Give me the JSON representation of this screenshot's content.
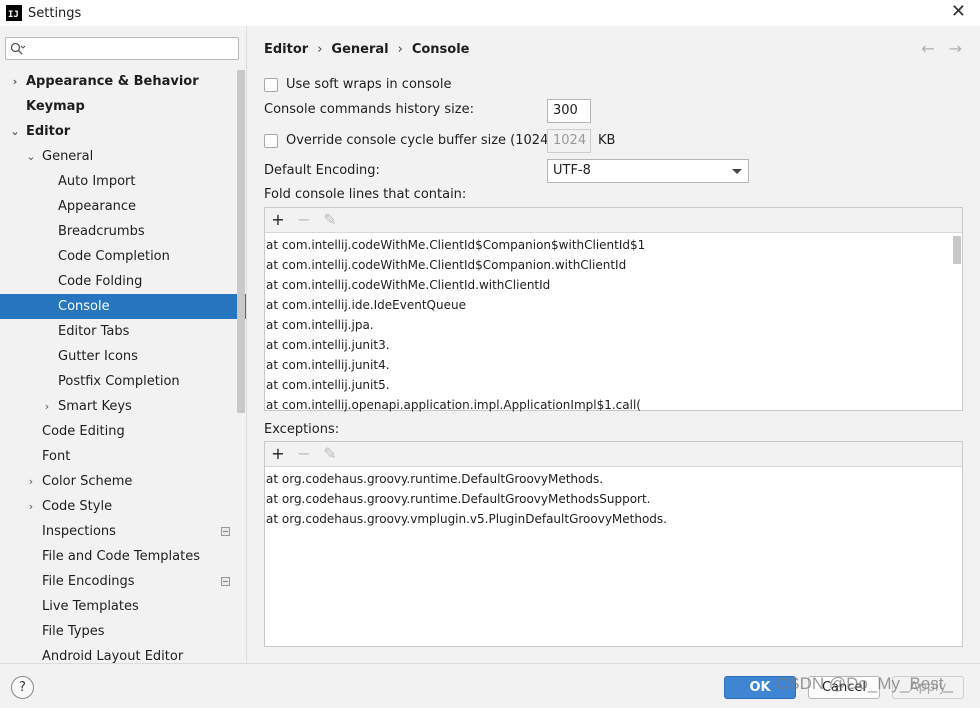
{
  "window": {
    "title": "Settings",
    "logo_text": "IJ"
  },
  "sidebar": {
    "search_placeholder": "",
    "items": [
      {
        "label": "Appearance & Behavior",
        "bold": true,
        "level": 0,
        "arrow": "›",
        "selected": false,
        "scope_icon": false
      },
      {
        "label": "Keymap",
        "bold": true,
        "level": 0,
        "arrow": "",
        "selected": false,
        "scope_icon": false
      },
      {
        "label": "Editor",
        "bold": true,
        "level": 0,
        "arrow": "⌄",
        "selected": false,
        "scope_icon": false
      },
      {
        "label": "General",
        "bold": false,
        "level": 1,
        "arrow": "⌄",
        "selected": false,
        "scope_icon": false
      },
      {
        "label": "Auto Import",
        "bold": false,
        "level": 2,
        "arrow": "",
        "selected": false,
        "scope_icon": false
      },
      {
        "label": "Appearance",
        "bold": false,
        "level": 2,
        "arrow": "",
        "selected": false,
        "scope_icon": false
      },
      {
        "label": "Breadcrumbs",
        "bold": false,
        "level": 2,
        "arrow": "",
        "selected": false,
        "scope_icon": false
      },
      {
        "label": "Code Completion",
        "bold": false,
        "level": 2,
        "arrow": "",
        "selected": false,
        "scope_icon": false
      },
      {
        "label": "Code Folding",
        "bold": false,
        "level": 2,
        "arrow": "",
        "selected": false,
        "scope_icon": false
      },
      {
        "label": "Console",
        "bold": false,
        "level": 2,
        "arrow": "",
        "selected": true,
        "scope_icon": false
      },
      {
        "label": "Editor Tabs",
        "bold": false,
        "level": 2,
        "arrow": "",
        "selected": false,
        "scope_icon": false
      },
      {
        "label": "Gutter Icons",
        "bold": false,
        "level": 2,
        "arrow": "",
        "selected": false,
        "scope_icon": false
      },
      {
        "label": "Postfix Completion",
        "bold": false,
        "level": 2,
        "arrow": "",
        "selected": false,
        "scope_icon": false
      },
      {
        "label": "Smart Keys",
        "bold": false,
        "level": 2,
        "arrow": "›",
        "selected": false,
        "scope_icon": false
      },
      {
        "label": "Code Editing",
        "bold": false,
        "level": 1,
        "arrow": "",
        "selected": false,
        "scope_icon": false
      },
      {
        "label": "Font",
        "bold": false,
        "level": 1,
        "arrow": "",
        "selected": false,
        "scope_icon": false
      },
      {
        "label": "Color Scheme",
        "bold": false,
        "level": 1,
        "arrow": "›",
        "selected": false,
        "scope_icon": false
      },
      {
        "label": "Code Style",
        "bold": false,
        "level": 1,
        "arrow": "›",
        "selected": false,
        "scope_icon": false
      },
      {
        "label": "Inspections",
        "bold": false,
        "level": 1,
        "arrow": "",
        "selected": false,
        "scope_icon": true
      },
      {
        "label": "File and Code Templates",
        "bold": false,
        "level": 1,
        "arrow": "",
        "selected": false,
        "scope_icon": false
      },
      {
        "label": "File Encodings",
        "bold": false,
        "level": 1,
        "arrow": "",
        "selected": false,
        "scope_icon": true
      },
      {
        "label": "Live Templates",
        "bold": false,
        "level": 1,
        "arrow": "",
        "selected": false,
        "scope_icon": false
      },
      {
        "label": "File Types",
        "bold": false,
        "level": 1,
        "arrow": "",
        "selected": false,
        "scope_icon": false
      },
      {
        "label": "Android Layout Editor",
        "bold": false,
        "level": 1,
        "arrow": "",
        "selected": false,
        "scope_icon": false
      }
    ]
  },
  "breadcrumb": {
    "items": [
      "Editor",
      "General",
      "Console"
    ],
    "separator": "›"
  },
  "nav": {
    "back": "←",
    "forward": "→"
  },
  "settings": {
    "soft_wraps_label": "Use soft wraps in console",
    "soft_wraps_checked": false,
    "history_label": "Console commands history size:",
    "history_value": "300",
    "override_label": "Override console cycle buffer size (1024 KB)",
    "override_checked": false,
    "buffer_value": "1024",
    "buffer_unit": "KB",
    "encoding_label": "Default Encoding:",
    "encoding_value": "UTF-8",
    "fold_label": "Fold console lines that contain:",
    "exceptions_label": "Exceptions:"
  },
  "toolbar": {
    "add": "+",
    "remove": "−",
    "edit": "✎"
  },
  "fold_lines": [
    "at com.intellij.codeWithMe.ClientId$Companion$withClientId$1",
    "at com.intellij.codeWithMe.ClientId$Companion.withClientId",
    "at com.intellij.codeWithMe.ClientId.withClientId",
    "at com.intellij.ide.IdeEventQueue",
    "at com.intellij.jpa.",
    "at com.intellij.junit3.",
    "at com.intellij.junit4.",
    "at com.intellij.junit5.",
    "at com.intellij.openapi.application.impl.ApplicationImpl$1.call("
  ],
  "exceptions": [
    "at org.codehaus.groovy.runtime.DefaultGroovyMethods.",
    "at org.codehaus.groovy.runtime.DefaultGroovyMethodsSupport.",
    "at org.codehaus.groovy.vmplugin.v5.PluginDefaultGroovyMethods."
  ],
  "footer": {
    "help": "?",
    "ok": "OK",
    "cancel": "Cancel",
    "apply": "Apply",
    "watermark": "CSDN @Do_My_Best_"
  },
  "colors": {
    "accent": "#2675bf",
    "ok_button": "#3e86d4",
    "background": "#f2f2f2"
  }
}
